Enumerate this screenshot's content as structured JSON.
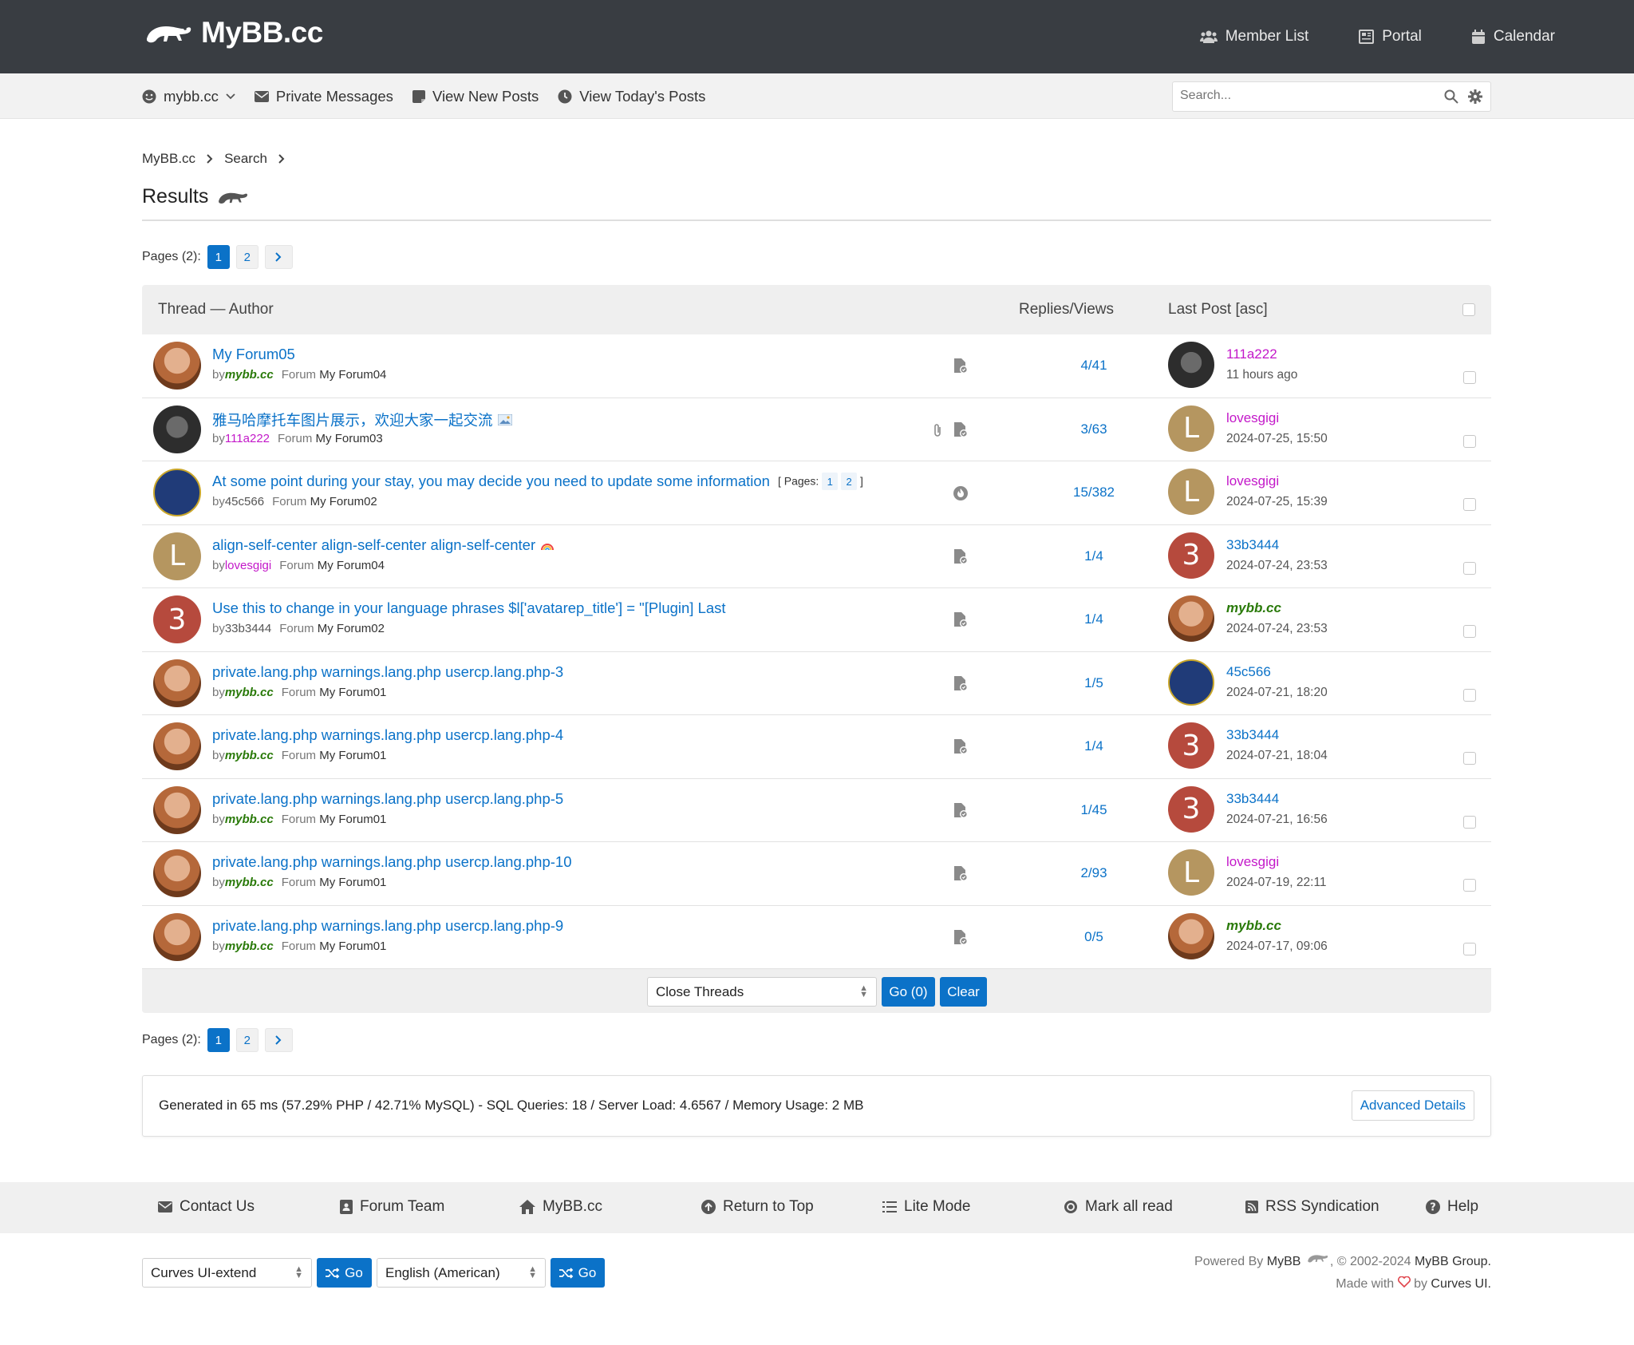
{
  "header": {
    "logo_text": "MyBB.cc",
    "nav": [
      {
        "label": "Member List",
        "icon": "users-icon"
      },
      {
        "label": "Portal",
        "icon": "newspaper-icon"
      },
      {
        "label": "Calendar",
        "icon": "calendar-icon"
      }
    ]
  },
  "userbar": {
    "username": "mybb.cc",
    "private_messages": "Private Messages",
    "view_new_posts": "View New Posts",
    "view_todays_posts": "View Today's Posts",
    "search_placeholder": "Search..."
  },
  "breadcrumb": {
    "home": "MyBB.cc",
    "current": "Search"
  },
  "page_title": "Results",
  "pagination": {
    "label": "Pages (2):",
    "pages": [
      "1",
      "2"
    ],
    "current": "1"
  },
  "table": {
    "headers": {
      "thread": "Thread — Author",
      "replies": "Replies/Views",
      "last_post": "Last Post [asc]"
    },
    "rows": [
      {
        "title": "My Forum05",
        "author": "mybb.cc",
        "forum": "My Forum04",
        "rv": "4/41",
        "lp_user": "111a222",
        "lp_date": "11 hours ago"
      },
      {
        "title": "雅马哈摩托车图片展示，欢迎大家一起交流",
        "author": "111a222",
        "forum": "My Forum03",
        "rv": "3/63",
        "lp_user": "lovesgigi",
        "lp_date": "2024-07-25, 15:50"
      },
      {
        "title": "At some point during your stay, you may decide you need to update some information",
        "pages_label": "[ Pages:",
        "pages_end": "]",
        "author": "45c566",
        "forum": "My Forum02",
        "rv": "15/382",
        "lp_user": "lovesgigi",
        "lp_date": "2024-07-25, 15:39"
      },
      {
        "title": "align-self-center align-self-center align-self-center",
        "author": "lovesgigi",
        "forum": "My Forum04",
        "rv": "1/4",
        "lp_user": "33b3444",
        "lp_date": "2024-07-24, 23:53"
      },
      {
        "title": "Use this to change in your language phrases $l['avatarep_title'] = \"[Plugin] Last",
        "author": "33b3444",
        "forum": "My Forum02",
        "rv": "1/4",
        "lp_user": "mybb.cc",
        "lp_date": "2024-07-24, 23:53"
      },
      {
        "title": "private.lang.php warnings.lang.php usercp.lang.php-3",
        "author": "mybb.cc",
        "forum": "My Forum01",
        "rv": "1/5",
        "lp_user": "45c566",
        "lp_date": "2024-07-21, 18:20"
      },
      {
        "title": "private.lang.php warnings.lang.php usercp.lang.php-4",
        "author": "mybb.cc",
        "forum": "My Forum01",
        "rv": "1/4",
        "lp_user": "33b3444",
        "lp_date": "2024-07-21, 18:04"
      },
      {
        "title": "private.lang.php warnings.lang.php usercp.lang.php-5",
        "author": "mybb.cc",
        "forum": "My Forum01",
        "rv": "1/45",
        "lp_user": "33b3444",
        "lp_date": "2024-07-21, 16:56"
      },
      {
        "title": "private.lang.php warnings.lang.php usercp.lang.php-10",
        "author": "mybb.cc",
        "forum": "My Forum01",
        "rv": "2/93",
        "lp_user": "lovesgigi",
        "lp_date": "2024-07-19, 22:11"
      },
      {
        "title": "private.lang.php warnings.lang.php usercp.lang.php-9",
        "author": "mybb.cc",
        "forum": "My Forum01",
        "rv": "0/5",
        "lp_user": "mybb.cc",
        "lp_date": "2024-07-17, 09:06"
      }
    ],
    "by": "by",
    "forum_label": "Forum",
    "moderation_select": "Close Threads",
    "go_button": "Go (0)",
    "clear_button": "Clear"
  },
  "debug": {
    "text": "Generated in 65 ms (57.29% PHP / 42.71% MySQL) - SQL Queries: 18 / Server Load: 4.6567 / Memory Usage: 2 MB",
    "advanced": "Advanced Details"
  },
  "footer": {
    "links": [
      "Contact Us",
      "Forum Team",
      "MyBB.cc",
      "Return to Top",
      "Lite Mode",
      "Mark all read",
      "RSS Syndication",
      "Help"
    ],
    "theme_select": "Curves UI-extend",
    "lang_select": "English (American)",
    "go": "Go",
    "powered_prefix": "Powered By",
    "powered_mybb": "MyBB",
    "copyright": ", © 2002-2024",
    "group": "MyBB Group.",
    "made_with": "Made with",
    "by": "by",
    "curves": "Curves UI."
  },
  "colors": {
    "accent": "#0b72c8",
    "topbar": "#393d42",
    "admin_green": "#2a7a0a",
    "member_pink": "#c318c9"
  }
}
